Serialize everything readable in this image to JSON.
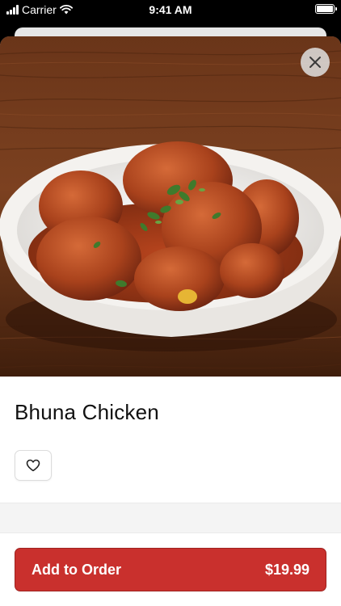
{
  "status_bar": {
    "carrier": "Carrier",
    "time": "9:41 AM"
  },
  "item": {
    "name": "Bhuna Chicken"
  },
  "order_button": {
    "label": "Add to Order",
    "price": "$19.99"
  },
  "colors": {
    "accent": "#c9302d"
  },
  "icons": {
    "close": "close-icon",
    "favorite": "heart-icon",
    "wifi": "wifi-icon",
    "battery": "battery-icon",
    "signal": "signal-icon"
  }
}
